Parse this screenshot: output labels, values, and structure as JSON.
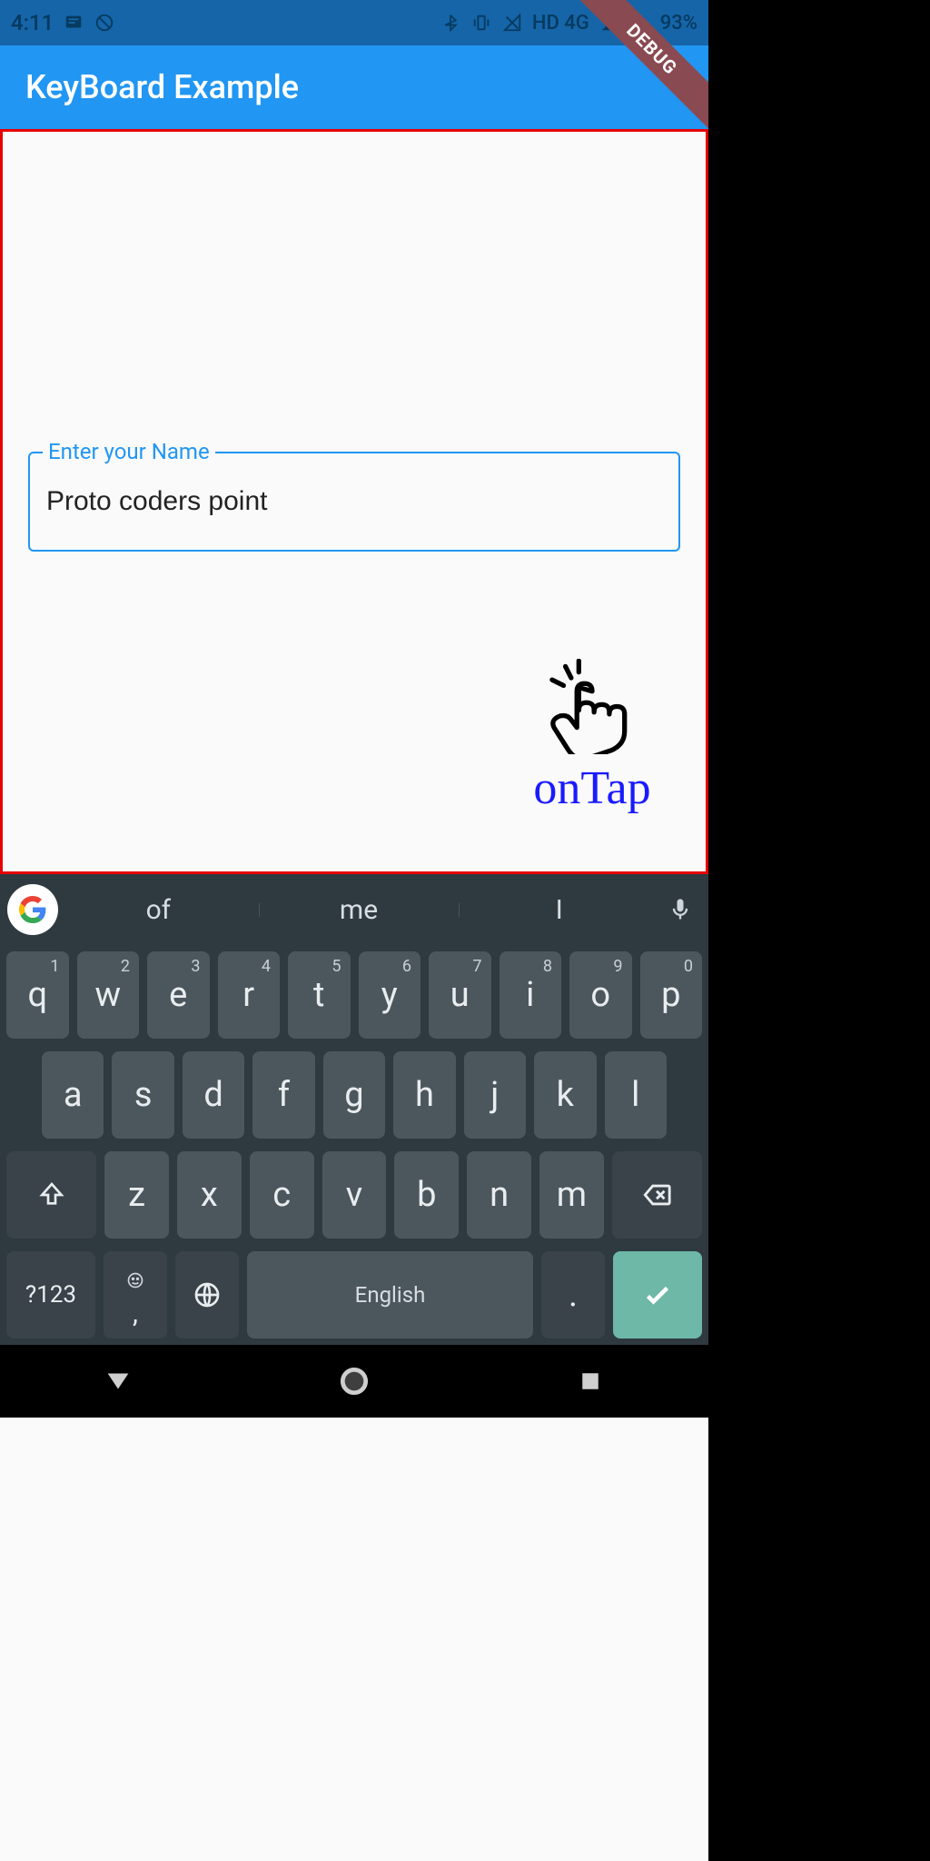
{
  "statusbar": {
    "time": "4:11",
    "battery": "93%",
    "network": "HD 4G"
  },
  "appbar": {
    "title": "KeyBoard Example"
  },
  "debug_banner": "DEBUG",
  "form": {
    "name_label": "Enter your Name",
    "name_value": "Proto coders point"
  },
  "overlay": {
    "tap_label": "onTap"
  },
  "keyboard": {
    "suggestions": [
      "of",
      "me",
      "I"
    ],
    "row1": [
      {
        "k": "q",
        "n": "1"
      },
      {
        "k": "w",
        "n": "2"
      },
      {
        "k": "e",
        "n": "3"
      },
      {
        "k": "r",
        "n": "4"
      },
      {
        "k": "t",
        "n": "5"
      },
      {
        "k": "y",
        "n": "6"
      },
      {
        "k": "u",
        "n": "7"
      },
      {
        "k": "i",
        "n": "8"
      },
      {
        "k": "o",
        "n": "9"
      },
      {
        "k": "p",
        "n": "0"
      }
    ],
    "row2": [
      "a",
      "s",
      "d",
      "f",
      "g",
      "h",
      "j",
      "k",
      "l"
    ],
    "row3": [
      "z",
      "x",
      "c",
      "v",
      "b",
      "n",
      "m"
    ],
    "symbols_key": "?123",
    "comma_key": ",",
    "space_label": "English",
    "period_key": "."
  }
}
